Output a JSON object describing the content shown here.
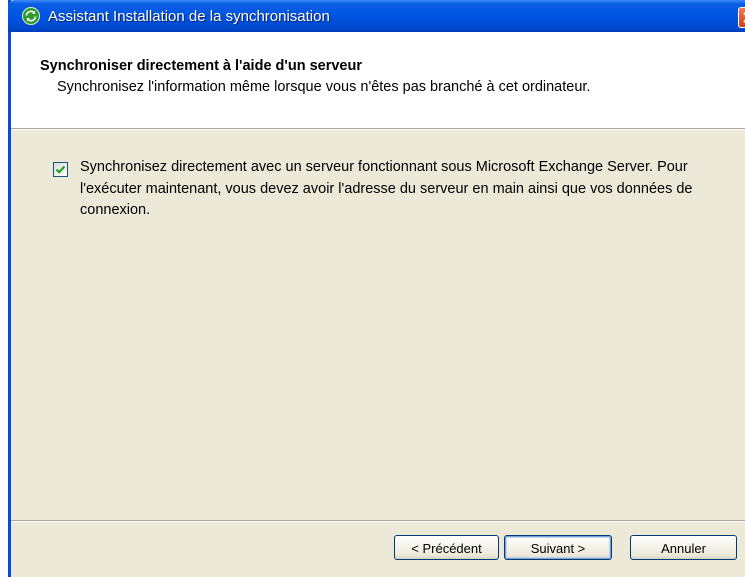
{
  "window": {
    "title": "Assistant Installation de la synchronisation"
  },
  "header": {
    "title": "Synchroniser directement à l'aide d'un serveur",
    "subtitle": "Synchronisez l'information même lorsque vous n'êtes pas branché à cet ordinateur."
  },
  "option": {
    "checked": true,
    "label": "Synchronisez directement avec un serveur fonctionnant sous Microsoft Exchange Server. Pour l'exécuter maintenant, vous devez avoir l'adresse du serveur en main ainsi que vos données de connexion."
  },
  "buttons": {
    "back": "< Précédent",
    "next": "Suivant >",
    "cancel": "Annuler"
  },
  "colors": {
    "titlebar": "#0054e3",
    "dialog_bg": "#ece9d8",
    "check": "#21a121"
  }
}
